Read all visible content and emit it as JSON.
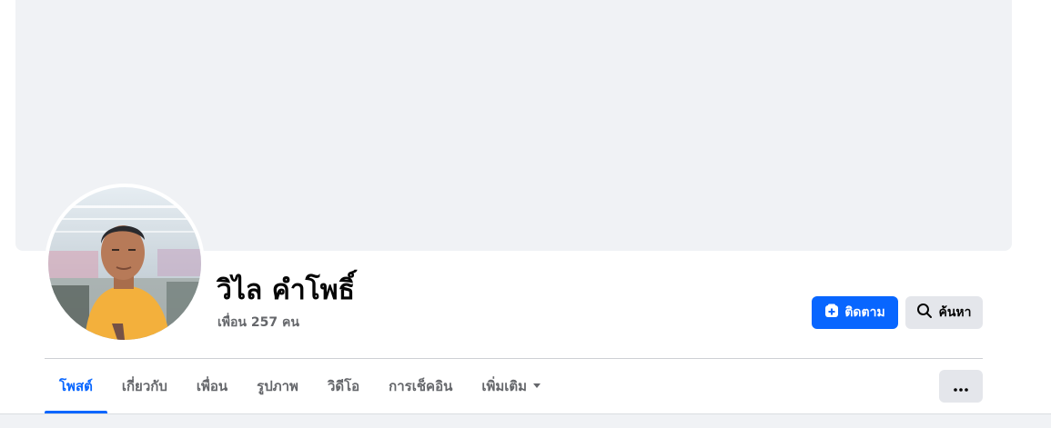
{
  "profile": {
    "name": "วิไล คำโพธิ์",
    "friends_text": "เพื่อน 257 คน",
    "avatar": "profile-photo"
  },
  "actions": {
    "follow_label": "ติดตาม",
    "follow_icon": "follow-plus-icon",
    "search_label": "ค้นหา",
    "search_icon": "search-icon"
  },
  "tabs": [
    {
      "label": "โพสต์",
      "active": true
    },
    {
      "label": "เกี่ยวกับ",
      "active": false
    },
    {
      "label": "เพื่อน",
      "active": false
    },
    {
      "label": "รูปภาพ",
      "active": false
    },
    {
      "label": "วิดีโอ",
      "active": false
    },
    {
      "label": "การเช็คอิน",
      "active": false
    },
    {
      "label": "เพิ่มเติม",
      "active": false,
      "dropdown": true
    }
  ],
  "more_button_icon": "ellipsis-icon",
  "colors": {
    "accent": "#0866ff",
    "cover": "#f0f2f5",
    "button_gray": "#e4e6eb",
    "secondary_text": "#65676b"
  }
}
